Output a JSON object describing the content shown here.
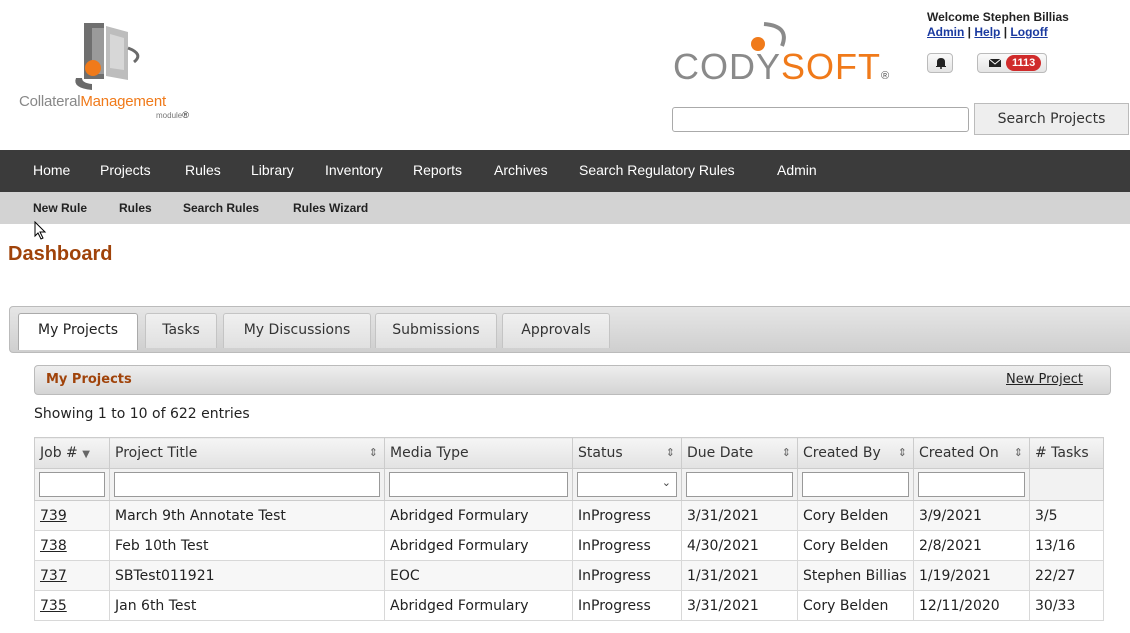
{
  "logo": {
    "text_main": "Collateral",
    "text_accent": "Management",
    "sub": "module"
  },
  "brand": {
    "part1": "CODY",
    "part2": "SOFT",
    "reg": "®"
  },
  "user": {
    "welcome": "Welcome Stephen Billias",
    "links": [
      "Admin",
      "Help",
      "Logoff"
    ],
    "mail_count": "1113"
  },
  "search": {
    "value": "",
    "button": "Search Projects"
  },
  "nav": [
    "Home",
    "Projects",
    "Rules",
    "Library",
    "Inventory",
    "Reports",
    "Archives",
    "Search Regulatory Rules",
    "Admin"
  ],
  "subnav": [
    "New Rule",
    "Rules",
    "Search Rules",
    "Rules Wizard"
  ],
  "page_title": "Dashboard",
  "tabs": [
    "My Projects",
    "Tasks",
    "My Discussions",
    "Submissions",
    "Approvals"
  ],
  "panel": {
    "title": "My Projects",
    "new_link": "New Project",
    "entries": "Showing 1 to 10 of 622 entries"
  },
  "table": {
    "headers": [
      "Job #",
      "Project Title",
      "Media Type",
      "Status",
      "Due Date",
      "Created By",
      "Created On",
      "# Tasks"
    ],
    "rows": [
      [
        "739",
        "March 9th Annotate Test",
        "Abridged Formulary",
        "InProgress",
        "3/31/2021",
        "Cory Belden",
        "3/9/2021",
        "3/5"
      ],
      [
        "738",
        "Feb 10th Test",
        "Abridged Formulary",
        "InProgress",
        "4/30/2021",
        "Cory Belden",
        "2/8/2021",
        "13/16"
      ],
      [
        "737",
        "SBTest011921",
        "EOC",
        "InProgress",
        "1/31/2021",
        "Stephen Billias",
        "1/19/2021",
        "22/27"
      ],
      [
        "735",
        "Jan 6th Test",
        "Abridged Formulary",
        "InProgress",
        "3/31/2021",
        "Cory Belden",
        "12/11/2020",
        "30/33"
      ]
    ]
  },
  "colors": {
    "accent": "#f07a1a",
    "title": "#a0430a",
    "nav_bg": "#3b3b3b",
    "badge": "#d02b2b"
  },
  "icons": {
    "bell": "bell-icon",
    "mail": "envelope-icon",
    "cursor": "mouse-pointer-icon"
  }
}
